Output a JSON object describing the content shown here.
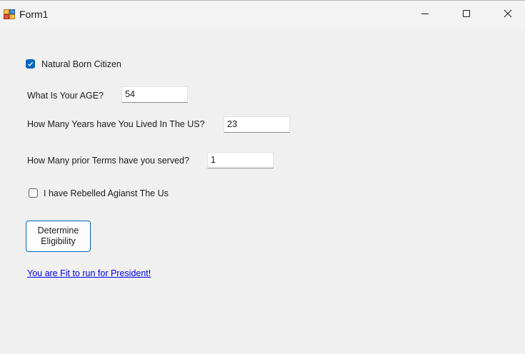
{
  "window": {
    "title": "Form1",
    "icon": "winforms-app-icon",
    "controls": {
      "minimize_icon": "minimize-icon",
      "maximize_icon": "maximize-icon",
      "close_icon": "close-icon"
    }
  },
  "form": {
    "natural_born": {
      "label": "Natural Born Citizen",
      "checked": true
    },
    "age": {
      "label": "What Is Your AGE?",
      "value": "54"
    },
    "years_in_us": {
      "label": "How Many Years have You Lived In The US?",
      "value": "23"
    },
    "prior_terms": {
      "label": "How Many prior Terms have you served?",
      "value": "1"
    },
    "rebelled": {
      "label": "I have Rebelled Agianst The Us",
      "checked": false
    },
    "determine_button": {
      "label": "Determine\nEligibility"
    },
    "result": {
      "text": "You are Fit to run for President!"
    }
  },
  "colors": {
    "accent": "#0067c0",
    "link": "#0000ee",
    "background": "#f0f0f0"
  }
}
